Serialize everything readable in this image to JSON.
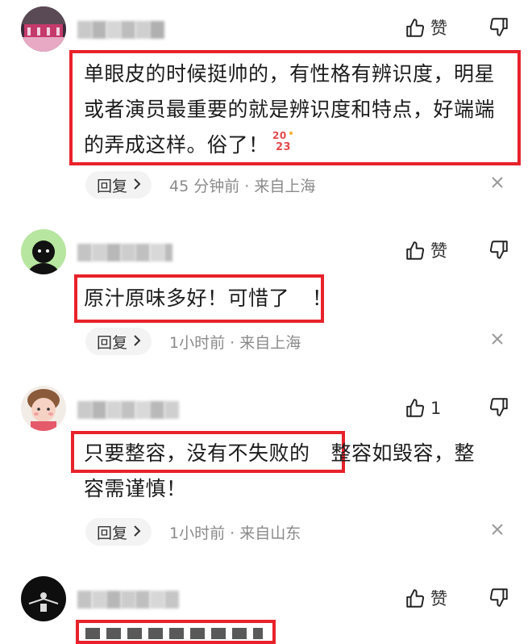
{
  "comments": [
    {
      "like_label": "赞",
      "content": "单眼皮的时候挺帅的，有性格有辨识度，明星或者演员最重要的就是辨识度和特点，好端端的弄成这样。俗了！",
      "emoji": "2023",
      "reply_label": "回复",
      "meta": "45 分钟前 · 来自上海"
    },
    {
      "like_label": "赞",
      "content_boxed": "原汁原味多好！可惜了",
      "content_tail": "！",
      "reply_label": "回复",
      "meta": "1小时前 · 来自上海"
    },
    {
      "like_label": "1",
      "content_boxed": "只要整容，没有不失败的",
      "content_tail_line1": "整容如毁容，整",
      "content_line2": "容需谨慎！",
      "reply_label": "回复",
      "meta": "1小时前 · 来自山东"
    },
    {
      "like_label": "赞"
    }
  ],
  "colors": {
    "highlight_box": "#e8222a",
    "meta_text": "#8a8a8a",
    "reply_bg": "#f3f3f3"
  },
  "icons": [
    "thumbs-up-icon",
    "thumbs-down-icon",
    "chevron-right-icon",
    "close-icon"
  ]
}
